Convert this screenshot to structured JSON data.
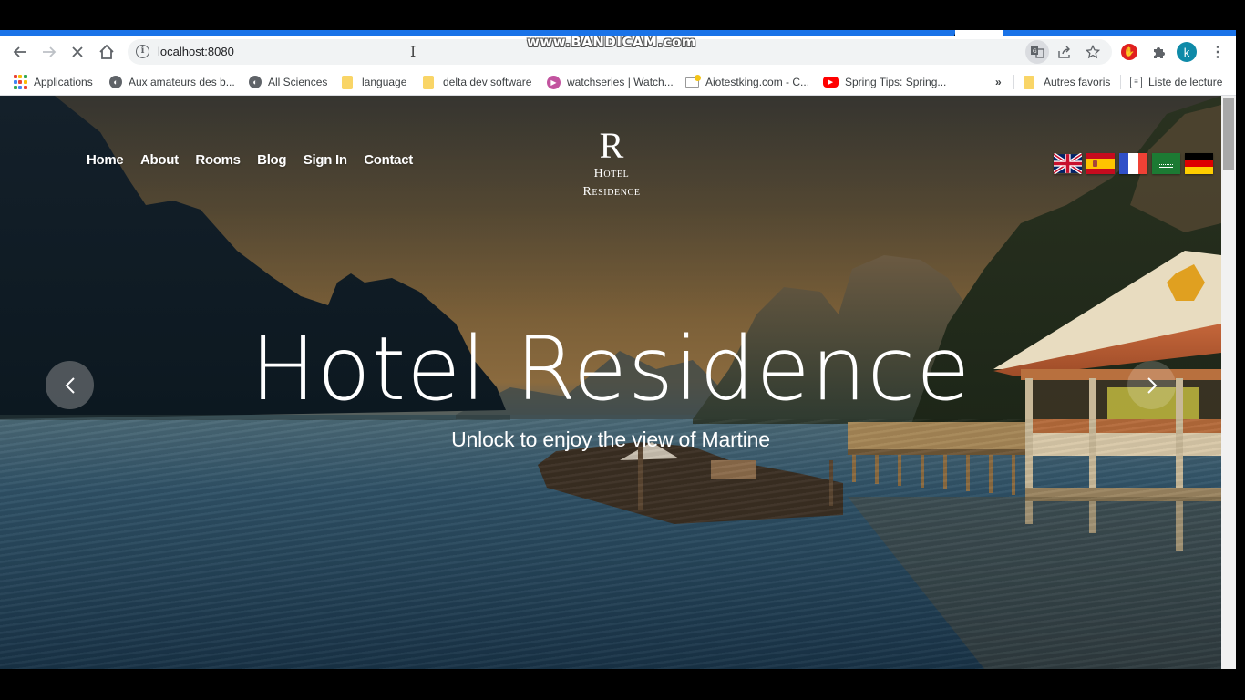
{
  "browser": {
    "address_bar": {
      "url": "localhost:8080"
    },
    "watermark": "www.BANDICAM.com",
    "profile_initial": "k",
    "bookmarks": [
      {
        "label": "Applications",
        "icon": "apps-grid-icon"
      },
      {
        "label": "Aux amateurs des b...",
        "icon": "globe-icon"
      },
      {
        "label": "All Sciences",
        "icon": "globe-icon"
      },
      {
        "label": "language",
        "icon": "folder-icon"
      },
      {
        "label": "delta dev software",
        "icon": "folder-icon"
      },
      {
        "label": "watchseries | Watch...",
        "icon": "play-icon"
      },
      {
        "label": "Aiotestking.com - C...",
        "icon": "mail-icon"
      },
      {
        "label": "Spring Tips: Spring...",
        "icon": "youtube-icon"
      }
    ],
    "bookmarks_overflow": "»",
    "other_bookmarks": "Autres favoris",
    "reading_list": "Liste de lecture"
  },
  "site": {
    "nav": [
      "Home",
      "About",
      "Rooms",
      "Blog",
      "Sign In",
      "Contact"
    ],
    "logo": {
      "mark": "R",
      "line1": "Hotel",
      "line2": "Residence"
    },
    "languages": [
      {
        "code": "en",
        "name": "English",
        "icon": "uk-flag-icon"
      },
      {
        "code": "es",
        "name": "Spanish",
        "icon": "spain-flag-icon"
      },
      {
        "code": "fr",
        "name": "French",
        "icon": "france-flag-icon"
      },
      {
        "code": "ar",
        "name": "Arabic",
        "icon": "saudi-flag-icon"
      },
      {
        "code": "de",
        "name": "German",
        "icon": "germany-flag-icon"
      }
    ],
    "hero": {
      "title": "Hotel Residence",
      "subtitle": "Unlock to enjoy the view of Martine"
    }
  },
  "colors": {
    "chrome_accent": "#1a73e8",
    "avatar": "#0e8aa8"
  }
}
